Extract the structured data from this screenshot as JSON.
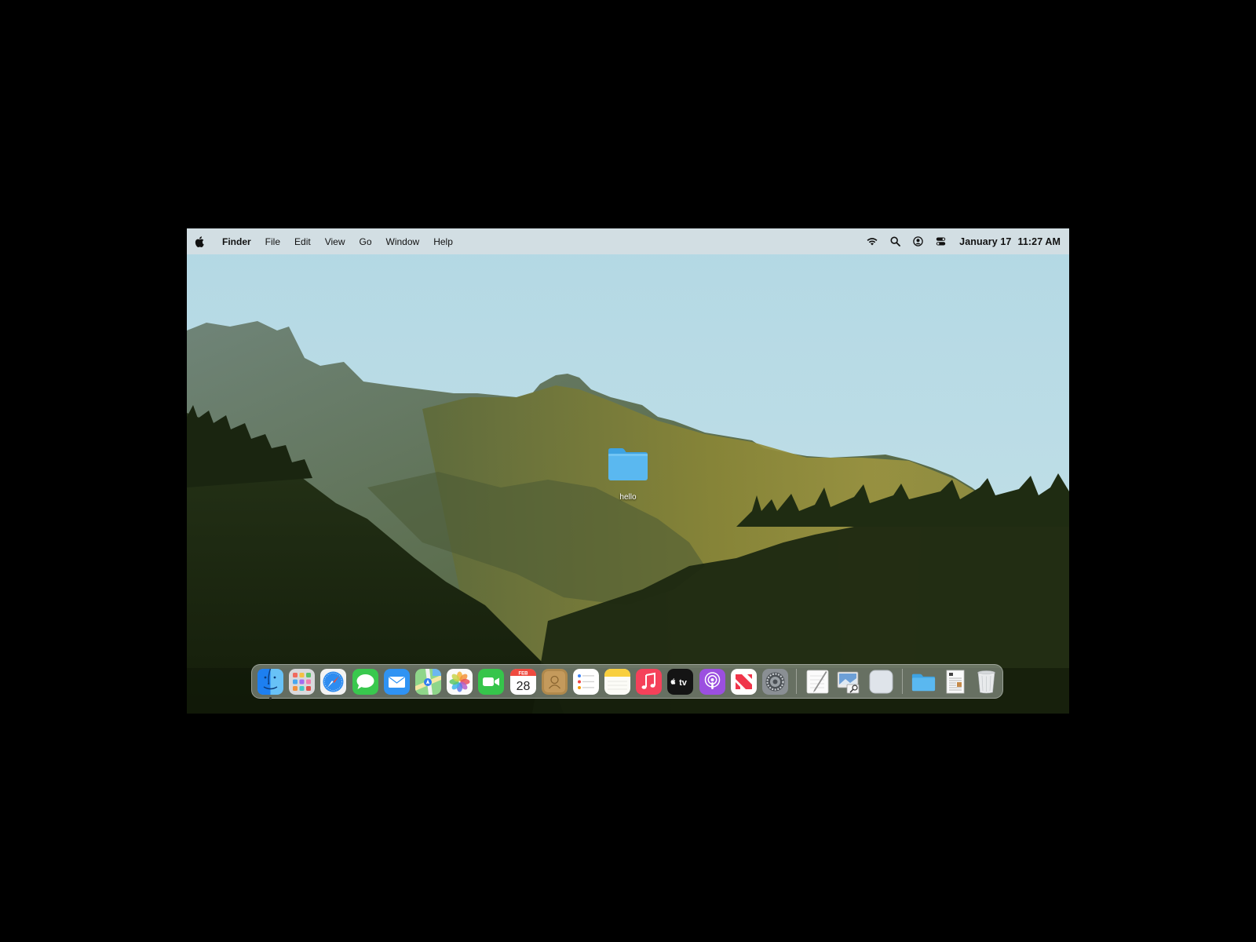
{
  "menubar": {
    "app_name": "Finder",
    "menus": [
      "File",
      "Edit",
      "View",
      "Go",
      "Window",
      "Help"
    ],
    "status_icons": [
      "wifi-icon",
      "spotlight-search-icon",
      "user-account-icon",
      "control-center-icon"
    ],
    "date": "January 17",
    "time": "11:27 AM"
  },
  "desktop": {
    "folder": {
      "label": "hello",
      "icon": "folder-icon"
    }
  },
  "dock": {
    "apps": [
      {
        "name": "Finder",
        "icon": "finder-icon",
        "running": true
      },
      {
        "name": "Launchpad",
        "icon": "launchpad-icon"
      },
      {
        "name": "Safari",
        "icon": "safari-icon"
      },
      {
        "name": "Messages",
        "icon": "messages-icon"
      },
      {
        "name": "Mail",
        "icon": "mail-icon"
      },
      {
        "name": "Maps",
        "icon": "maps-icon"
      },
      {
        "name": "Photos",
        "icon": "photos-icon"
      },
      {
        "name": "FaceTime",
        "icon": "facetime-icon"
      },
      {
        "name": "Calendar",
        "icon": "calendar-icon",
        "month": "FEB",
        "day": "28"
      },
      {
        "name": "Contacts",
        "icon": "contacts-icon"
      },
      {
        "name": "Reminders",
        "icon": "reminders-icon"
      },
      {
        "name": "Notes",
        "icon": "notes-icon"
      },
      {
        "name": "Music",
        "icon": "music-icon"
      },
      {
        "name": "TV",
        "icon": "tv-icon",
        "label": "tv"
      },
      {
        "name": "Podcasts",
        "icon": "podcasts-icon"
      },
      {
        "name": "News",
        "icon": "news-icon"
      },
      {
        "name": "System Settings",
        "icon": "system-settings-icon"
      }
    ],
    "recent": [
      {
        "name": "TextEdit",
        "icon": "textedit-icon"
      },
      {
        "name": "Preview",
        "icon": "preview-icon"
      },
      {
        "name": "Blank App",
        "icon": "blank-app-icon"
      }
    ],
    "stacks": [
      {
        "name": "Folder",
        "icon": "folder-icon"
      },
      {
        "name": "Document",
        "icon": "document-icon"
      },
      {
        "name": "Trash",
        "icon": "trash-icon"
      }
    ]
  },
  "colors": {
    "sky": "#b8dce6",
    "menubar": "#d6dee2",
    "folder_blue": "#5ab8f0",
    "grass": "#7c7a30",
    "forest": "#1e2a12"
  }
}
